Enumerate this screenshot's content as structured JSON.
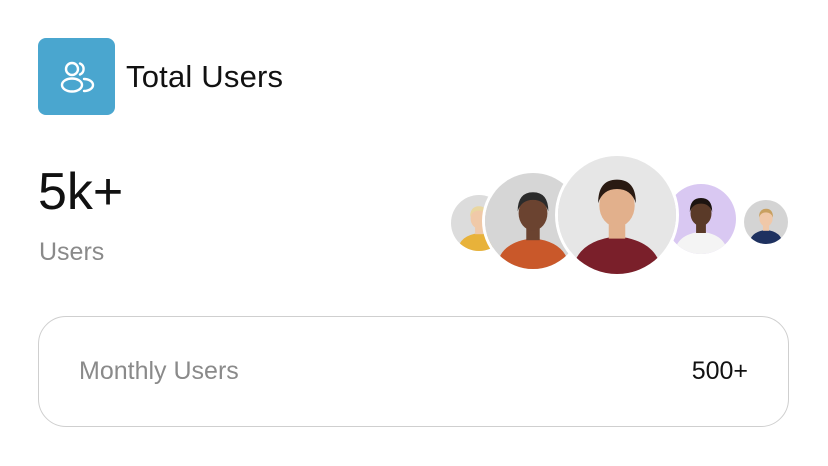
{
  "header": {
    "title": "Total Users",
    "icon": "users-icon",
    "icon_bg": "#4aa6cf"
  },
  "stats": {
    "value": "5k+",
    "label": "Users"
  },
  "avatars": [
    {
      "name": "avatar-1",
      "bg": "#dcdcdc",
      "shirt": "#e8b23a",
      "skin": "#f0c9a8",
      "hair": "#e9d6a0"
    },
    {
      "name": "avatar-2",
      "bg": "#d6d6d6",
      "shirt": "#c9582a",
      "skin": "#6b4330",
      "hair": "#2b2b2b"
    },
    {
      "name": "avatar-3",
      "bg": "#e6e6e6",
      "shirt": "#7a1f2a",
      "skin": "#e2b08c",
      "hair": "#2a1a12"
    },
    {
      "name": "avatar-4",
      "bg": "#d9c8f2",
      "shirt": "#f4f4f4",
      "skin": "#5a3a28",
      "hair": "#1c1410"
    },
    {
      "name": "avatar-5",
      "bg": "#d4d4d4",
      "shirt": "#1e3160",
      "skin": "#f0c8a8",
      "hair": "#c8a060"
    }
  ],
  "monthly": {
    "label": "Monthly Users",
    "value": "500+"
  }
}
